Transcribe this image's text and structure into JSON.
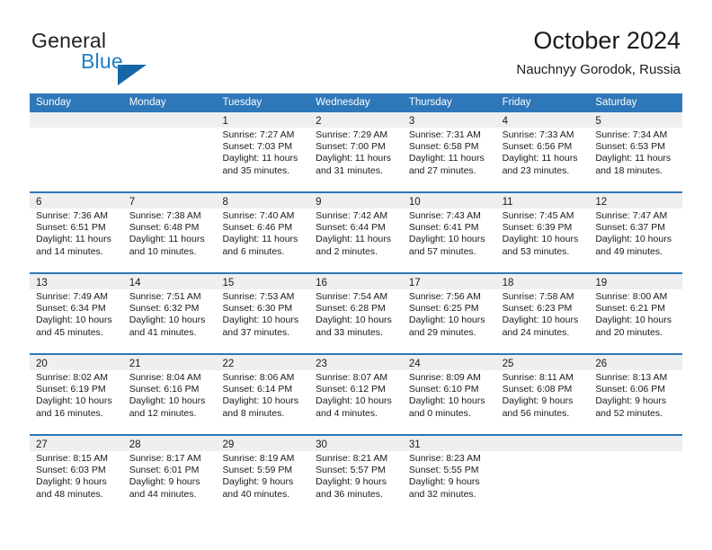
{
  "brand": {
    "name_part1": "General",
    "name_part2": "Blue",
    "colors": {
      "dark": "#231f20",
      "blue": "#1f7fc4",
      "triangle": "#1565a8"
    }
  },
  "header": {
    "title": "October 2024",
    "subtitle": "Nauchnyy Gorodok, Russia"
  },
  "theme": {
    "header_blue": "#2e77b8",
    "day_band_gray": "#efefef",
    "text": "#1a1a1a"
  },
  "weekdays": [
    "Sunday",
    "Monday",
    "Tuesday",
    "Wednesday",
    "Thursday",
    "Friday",
    "Saturday"
  ],
  "weeks": [
    [
      {
        "day": "",
        "lines": []
      },
      {
        "day": "",
        "lines": []
      },
      {
        "day": "1",
        "lines": [
          "Sunrise: 7:27 AM",
          "Sunset: 7:03 PM",
          "Daylight: 11 hours and 35 minutes."
        ]
      },
      {
        "day": "2",
        "lines": [
          "Sunrise: 7:29 AM",
          "Sunset: 7:00 PM",
          "Daylight: 11 hours and 31 minutes."
        ]
      },
      {
        "day": "3",
        "lines": [
          "Sunrise: 7:31 AM",
          "Sunset: 6:58 PM",
          "Daylight: 11 hours and 27 minutes."
        ]
      },
      {
        "day": "4",
        "lines": [
          "Sunrise: 7:33 AM",
          "Sunset: 6:56 PM",
          "Daylight: 11 hours and 23 minutes."
        ]
      },
      {
        "day": "5",
        "lines": [
          "Sunrise: 7:34 AM",
          "Sunset: 6:53 PM",
          "Daylight: 11 hours and 18 minutes."
        ]
      }
    ],
    [
      {
        "day": "6",
        "lines": [
          "Sunrise: 7:36 AM",
          "Sunset: 6:51 PM",
          "Daylight: 11 hours and 14 minutes."
        ]
      },
      {
        "day": "7",
        "lines": [
          "Sunrise: 7:38 AM",
          "Sunset: 6:48 PM",
          "Daylight: 11 hours and 10 minutes."
        ]
      },
      {
        "day": "8",
        "lines": [
          "Sunrise: 7:40 AM",
          "Sunset: 6:46 PM",
          "Daylight: 11 hours and 6 minutes."
        ]
      },
      {
        "day": "9",
        "lines": [
          "Sunrise: 7:42 AM",
          "Sunset: 6:44 PM",
          "Daylight: 11 hours and 2 minutes."
        ]
      },
      {
        "day": "10",
        "lines": [
          "Sunrise: 7:43 AM",
          "Sunset: 6:41 PM",
          "Daylight: 10 hours and 57 minutes."
        ]
      },
      {
        "day": "11",
        "lines": [
          "Sunrise: 7:45 AM",
          "Sunset: 6:39 PM",
          "Daylight: 10 hours and 53 minutes."
        ]
      },
      {
        "day": "12",
        "lines": [
          "Sunrise: 7:47 AM",
          "Sunset: 6:37 PM",
          "Daylight: 10 hours and 49 minutes."
        ]
      }
    ],
    [
      {
        "day": "13",
        "lines": [
          "Sunrise: 7:49 AM",
          "Sunset: 6:34 PM",
          "Daylight: 10 hours and 45 minutes."
        ]
      },
      {
        "day": "14",
        "lines": [
          "Sunrise: 7:51 AM",
          "Sunset: 6:32 PM",
          "Daylight: 10 hours and 41 minutes."
        ]
      },
      {
        "day": "15",
        "lines": [
          "Sunrise: 7:53 AM",
          "Sunset: 6:30 PM",
          "Daylight: 10 hours and 37 minutes."
        ]
      },
      {
        "day": "16",
        "lines": [
          "Sunrise: 7:54 AM",
          "Sunset: 6:28 PM",
          "Daylight: 10 hours and 33 minutes."
        ]
      },
      {
        "day": "17",
        "lines": [
          "Sunrise: 7:56 AM",
          "Sunset: 6:25 PM",
          "Daylight: 10 hours and 29 minutes."
        ]
      },
      {
        "day": "18",
        "lines": [
          "Sunrise: 7:58 AM",
          "Sunset: 6:23 PM",
          "Daylight: 10 hours and 24 minutes."
        ]
      },
      {
        "day": "19",
        "lines": [
          "Sunrise: 8:00 AM",
          "Sunset: 6:21 PM",
          "Daylight: 10 hours and 20 minutes."
        ]
      }
    ],
    [
      {
        "day": "20",
        "lines": [
          "Sunrise: 8:02 AM",
          "Sunset: 6:19 PM",
          "Daylight: 10 hours and 16 minutes."
        ]
      },
      {
        "day": "21",
        "lines": [
          "Sunrise: 8:04 AM",
          "Sunset: 6:16 PM",
          "Daylight: 10 hours and 12 minutes."
        ]
      },
      {
        "day": "22",
        "lines": [
          "Sunrise: 8:06 AM",
          "Sunset: 6:14 PM",
          "Daylight: 10 hours and 8 minutes."
        ]
      },
      {
        "day": "23",
        "lines": [
          "Sunrise: 8:07 AM",
          "Sunset: 6:12 PM",
          "Daylight: 10 hours and 4 minutes."
        ]
      },
      {
        "day": "24",
        "lines": [
          "Sunrise: 8:09 AM",
          "Sunset: 6:10 PM",
          "Daylight: 10 hours and 0 minutes."
        ]
      },
      {
        "day": "25",
        "lines": [
          "Sunrise: 8:11 AM",
          "Sunset: 6:08 PM",
          "Daylight: 9 hours and 56 minutes."
        ]
      },
      {
        "day": "26",
        "lines": [
          "Sunrise: 8:13 AM",
          "Sunset: 6:06 PM",
          "Daylight: 9 hours and 52 minutes."
        ]
      }
    ],
    [
      {
        "day": "27",
        "lines": [
          "Sunrise: 8:15 AM",
          "Sunset: 6:03 PM",
          "Daylight: 9 hours and 48 minutes."
        ]
      },
      {
        "day": "28",
        "lines": [
          "Sunrise: 8:17 AM",
          "Sunset: 6:01 PM",
          "Daylight: 9 hours and 44 minutes."
        ]
      },
      {
        "day": "29",
        "lines": [
          "Sunrise: 8:19 AM",
          "Sunset: 5:59 PM",
          "Daylight: 9 hours and 40 minutes."
        ]
      },
      {
        "day": "30",
        "lines": [
          "Sunrise: 8:21 AM",
          "Sunset: 5:57 PM",
          "Daylight: 9 hours and 36 minutes."
        ]
      },
      {
        "day": "31",
        "lines": [
          "Sunrise: 8:23 AM",
          "Sunset: 5:55 PM",
          "Daylight: 9 hours and 32 minutes."
        ]
      },
      {
        "day": "",
        "lines": []
      },
      {
        "day": "",
        "lines": []
      }
    ]
  ]
}
